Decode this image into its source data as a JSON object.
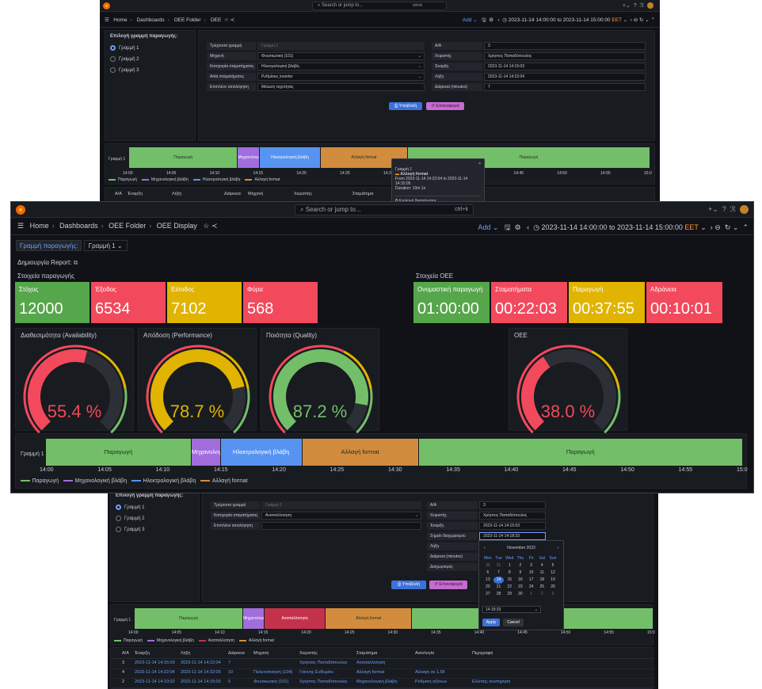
{
  "theme": {
    "green": "#73bf69",
    "red": "#f2495c",
    "yellow": "#e0b400",
    "purple": "#a16ddc",
    "blue": "#5794f2",
    "orange": "#ff9830",
    "orange_bar": "#d18c3e",
    "link": "#6e9fff"
  },
  "chrome": {
    "search_placeholder": "Search or jump to...",
    "kbd": "ctrl+k",
    "crumb_home": "Home",
    "crumb_dashboards": "Dashboards",
    "crumb_folder": "OEE Folder",
    "crumb_page_top": "OEE",
    "crumb_page_main": "OEE Display",
    "add_label": "Add",
    "time_range": "2023-11-14 14:00:00 to 2023-11-14 15:00:00",
    "timezone": "EET"
  },
  "shot1": {
    "select_title": "Επιλογή γραμμή παραγωγής:",
    "lines": [
      "Γραμμή 1",
      "Γραμμή 2",
      "Γραμμή 3"
    ],
    "form_left": [
      {
        "label": "Τρέχουσα γραμμή",
        "value": "Γραμμή 1",
        "dim": true
      },
      {
        "label": "Μηχανή",
        "value": "Φουσκωτική (101)",
        "select": true
      },
      {
        "label": "Κατηγορία σταματήματος",
        "value": "Ηλεκτρολογική βλάβη",
        "select": true
      },
      {
        "label": "Αιτία σταματήματος",
        "value": "Ρυθμίσεις inverter",
        "select": true
      },
      {
        "label": "Επιπλέον αιτιολόγηση",
        "value": "Μείωση ταχύτητας"
      }
    ],
    "form_right": [
      {
        "label": "Α/Α",
        "value": "3"
      },
      {
        "label": "Χειριστής",
        "value": "Χρήστος Παπαδόπουλος"
      },
      {
        "label": "Έναρξη",
        "value": "2023-11-14 14:15:03"
      },
      {
        "label": "Λήξη",
        "value": "2023-11-14 14:22:04"
      },
      {
        "label": "Διάρκεια (minutes)",
        "value": "7"
      }
    ],
    "submit": "Υποβολή",
    "reset": "Επαναφορά",
    "timeline_row": "Γραμμή 1",
    "tooltip": {
      "title": "Γραμμή 1",
      "state": "Αλλαγή format",
      "range": "From 2023-11-14 14:22:04 to 2023-11-14 14:32:05",
      "duration": "Duration: 10m 1s",
      "action": "Επιλογή διαστήματος"
    },
    "table_headers": [
      "Α/Α",
      "Έναρξη",
      "Λήξη",
      "Διάρκεια",
      "Μηχανή",
      "Χειριστής",
      "Σταμάτημα",
      "",
      "Περιγραφή"
    ]
  },
  "main": {
    "var_label": "Γραμμή παραγωγής:",
    "var_value": "Γραμμή 1",
    "report_label": "Δημιουργία Report:",
    "prod_title": "Στοιχεία παραγωγής",
    "oee_title": "Στοιχεία OEE",
    "prod_stats": [
      {
        "label": "Στόχος",
        "value": "12000",
        "color": "#56a64b"
      },
      {
        "label": "Έξοδος",
        "value": "6534",
        "color": "#f2495c"
      },
      {
        "label": "Είσοδος",
        "value": "7102",
        "color": "#e0b400"
      },
      {
        "label": "Φύρα",
        "value": "568",
        "color": "#f2495c"
      }
    ],
    "oee_stats": [
      {
        "label": "Ονομαστική παραγωγή",
        "value": "01:00:00",
        "color": "#56a64b"
      },
      {
        "label": "Σταματήματα",
        "value": "00:22:03",
        "color": "#f2495c"
      },
      {
        "label": "Παραγωγή",
        "value": "00:37:55",
        "color": "#e0b400"
      },
      {
        "label": "Αδράνεια",
        "value": "00:10:01",
        "color": "#f2495c"
      }
    ],
    "gauges": [
      {
        "title": "Διαθεσιμότητα (Availability)",
        "value": 55.4,
        "text": "55.4 %",
        "color": "#f2495c"
      },
      {
        "title": "Απόδοση (Performance)",
        "value": 78.7,
        "text": "78.7 %",
        "color": "#e0b400"
      },
      {
        "title": "Ποιότητα (Quality)",
        "value": 87.2,
        "text": "87.2 %",
        "color": "#73bf69"
      },
      {
        "title": "OEE",
        "value": 38.0,
        "text": "38.0 %",
        "color": "#f2495c"
      }
    ],
    "timeline_row": "Γραμμή 1"
  },
  "chart_data": {
    "type": "state-timeline",
    "row": "Γραμμή 1",
    "x_ticks": [
      "14:00",
      "14:05",
      "14:10",
      "14:15",
      "14:20",
      "14:25",
      "14:30",
      "14:35",
      "14:40",
      "14:45",
      "14:50",
      "14:55",
      "15:0"
    ],
    "segments": [
      {
        "state": "Παραγωγή",
        "start": "14:00:00",
        "end": "14:12:32"
      },
      {
        "state": "Μηχανολογική βλάβη",
        "start": "14:12:32",
        "end": "14:15:03"
      },
      {
        "state": "Ηλεκτρολογική βλάβη",
        "start": "14:15:03",
        "end": "14:22:04"
      },
      {
        "state": "Αλλαγή format",
        "start": "14:22:04",
        "end": "14:32:05"
      },
      {
        "state": "Παραγωγή",
        "start": "14:32:05",
        "end": "15:00:00"
      }
    ],
    "legend": [
      "Παραγωγή",
      "Μηχανολογική βλάβη",
      "Ηλεκτρολογική βλάβη",
      "Αλλαγή format"
    ]
  },
  "shot3": {
    "select_title": "Επιλογή γραμμή παραγωγής:",
    "lines": [
      "Γραμμή 1",
      "Γραμμή 2",
      "Γραμμή 3"
    ],
    "form_left": [
      {
        "label": "Τρέχουσα γραμμή",
        "value": "Γραμμή 1",
        "dim": true
      },
      {
        "label": "Κατηγορία σταματήματος",
        "value": "Αναπαλλοτηση",
        "select": true
      },
      {
        "label": "Επιπλέον αιτιολόγηση",
        "value": ""
      }
    ],
    "form_right": [
      {
        "label": "Α/Α",
        "value": "3"
      },
      {
        "label": "Χειριστής",
        "value": "Χρήστος Παπαδόπουλος"
      },
      {
        "label": "Έναρξη",
        "value": "2023-11-14 14:15:03"
      },
      {
        "label": "Σημείο διαχωρισμού",
        "value": "2023-11-14 14:18:33",
        "active": true
      },
      {
        "label": "Λήξη",
        "value": ""
      },
      {
        "label": "Διάρκεια (minutes)",
        "value": ""
      },
      {
        "label": "Διαχωρισμός",
        "value": ""
      }
    ],
    "calendar": {
      "month": "November 2023",
      "days": [
        "Mon",
        "Tue",
        "Wed",
        "Thu",
        "Fri",
        "Sat",
        "Sun"
      ],
      "cells": [
        "30",
        "31",
        "1",
        "2",
        "3",
        "4",
        "5",
        "6",
        "7",
        "8",
        "9",
        "10",
        "11",
        "12",
        "13",
        "14",
        "15",
        "16",
        "17",
        "18",
        "19",
        "20",
        "21",
        "22",
        "23",
        "24",
        "25",
        "26",
        "27",
        "28",
        "29",
        "30",
        "1",
        "2",
        "3"
      ],
      "selected": "14",
      "time": "14:18:33",
      "apply": "Apply",
      "cancel": "Cancel"
    },
    "submit": "Υποβολή",
    "reset": "Επαναφορά",
    "timeline_row": "Γραμμή 1",
    "segments": [
      "Παραγωγή",
      "Μηχανολογική βλάβη",
      "Αναπαλλοτηση",
      "Αλλαγή format",
      ""
    ],
    "legend": [
      "Παραγωγή",
      "Μηχανολογική βλάβη",
      "Αναπαλλοτηση",
      "Αλλαγή format"
    ],
    "table_headers": [
      "Α/Α",
      "Έναρξη",
      "Λήξη",
      "Διάρκεια",
      "Μηχανή",
      "Χειριστής",
      "Σταμάτημα",
      "Αιτιολογία",
      "Περιγραφή"
    ],
    "rows": [
      [
        "3",
        "2023-11-14 14:15:03",
        "2023-11-14 14:22:04",
        "7",
        "",
        "Χρήστος Παπαδόπουλος",
        "Αναπαλλοτηση",
        "",
        ""
      ],
      [
        "4",
        "2023-11-14 14:22:04",
        "2023-11-14 14:32:05",
        "10",
        "Παλετοποίηση (104)",
        "Γιάννης Ευθυμίου",
        "Αλλαγή format",
        "Αλλαγή σε 1,5lt",
        ""
      ],
      [
        "2",
        "2023-11-14 14:10:02",
        "2023-11-14 14:15:03",
        "5",
        "Φουσκωτική (101)",
        "Χρήστος Παπαδόπουλος",
        "Μηχανολογική βλάβη",
        "Ρύθμιση αξόνων",
        "Ελλιπής συντήρηση"
      ]
    ]
  }
}
